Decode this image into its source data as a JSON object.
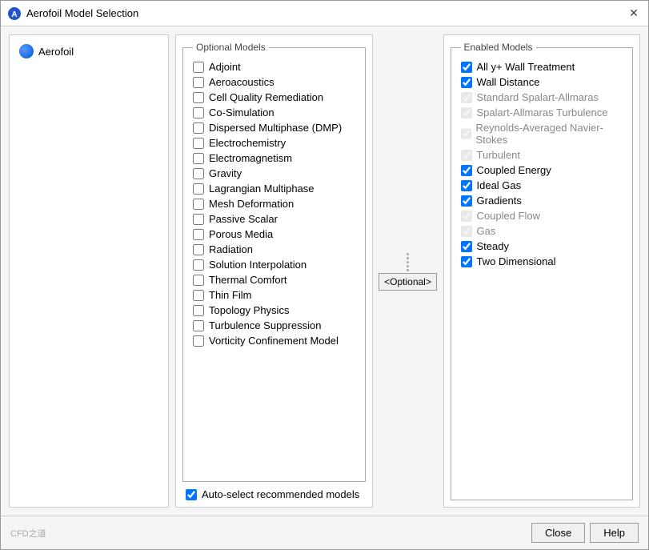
{
  "window": {
    "title": "Aerofoil Model Selection",
    "close_label": "✕"
  },
  "left_panel": {
    "item_label": "Aerofoil"
  },
  "optional_models": {
    "legend": "Optional Models",
    "items": [
      {
        "label": "Adjoint",
        "checked": false
      },
      {
        "label": "Aeroacoustics",
        "checked": false
      },
      {
        "label": "Cell Quality Remediation",
        "checked": false
      },
      {
        "label": "Co-Simulation",
        "checked": false
      },
      {
        "label": "Dispersed Multiphase (DMP)",
        "checked": false
      },
      {
        "label": "Electrochemistry",
        "checked": false
      },
      {
        "label": "Electromagnetism",
        "checked": false
      },
      {
        "label": "Gravity",
        "checked": false
      },
      {
        "label": "Lagrangian Multiphase",
        "checked": false
      },
      {
        "label": "Mesh Deformation",
        "checked": false
      },
      {
        "label": "Passive Scalar",
        "checked": false
      },
      {
        "label": "Porous Media",
        "checked": false
      },
      {
        "label": "Radiation",
        "checked": false
      },
      {
        "label": "Solution Interpolation",
        "checked": false
      },
      {
        "label": "Thermal Comfort",
        "checked": false
      },
      {
        "label": "Thin Film",
        "checked": false
      },
      {
        "label": "Topology Physics",
        "checked": false
      },
      {
        "label": "Turbulence Suppression",
        "checked": false
      },
      {
        "label": "Vorticity Confinement Model",
        "checked": false
      }
    ],
    "auto_select_label": "Auto-select recommended models",
    "auto_select_checked": true
  },
  "optional_button": {
    "label": "<Optional>"
  },
  "enabled_models": {
    "legend": "Enabled Models",
    "items": [
      {
        "label": "All y+ Wall Treatment",
        "checked": true,
        "greyed": false
      },
      {
        "label": "Wall Distance",
        "checked": true,
        "greyed": false
      },
      {
        "label": "Standard Spalart-Allmaras",
        "checked": true,
        "greyed": true
      },
      {
        "label": "Spalart-Allmaras Turbulence",
        "checked": true,
        "greyed": true
      },
      {
        "label": "Reynolds-Averaged Navier-Stokes",
        "checked": true,
        "greyed": true
      },
      {
        "label": "Turbulent",
        "checked": true,
        "greyed": true
      },
      {
        "label": "Coupled Energy",
        "checked": true,
        "greyed": false
      },
      {
        "label": "Ideal Gas",
        "checked": true,
        "greyed": false
      },
      {
        "label": "Gradients",
        "checked": true,
        "greyed": false
      },
      {
        "label": "Coupled Flow",
        "checked": true,
        "greyed": true
      },
      {
        "label": "Gas",
        "checked": true,
        "greyed": true
      },
      {
        "label": "Steady",
        "checked": true,
        "greyed": false
      },
      {
        "label": "Two Dimensional",
        "checked": true,
        "greyed": false
      }
    ]
  },
  "footer": {
    "close_label": "Close",
    "help_label": "Help"
  }
}
